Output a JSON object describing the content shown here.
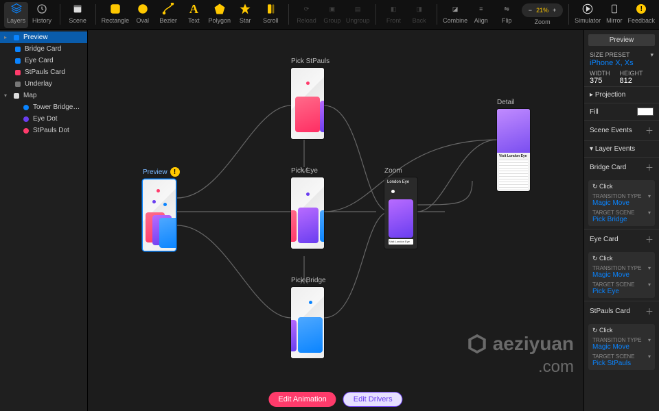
{
  "toolbar": {
    "layers": "Layers",
    "history": "History",
    "scene": "Scene",
    "rectangle": "Rectangle",
    "oval": "Oval",
    "bezier": "Bezier",
    "text": "Text",
    "polygon": "Polygon",
    "star": "Star",
    "scroll": "Scroll",
    "reload": "Reload",
    "group": "Group",
    "ungroup": "Ungroup",
    "front": "Front",
    "back": "Back",
    "combine": "Combine",
    "align": "Align",
    "flip": "Flip",
    "zoom": "Zoom",
    "zoom_value": "21%",
    "simulator": "Simulator",
    "mirror": "Mirror",
    "feedback": "Feedback"
  },
  "sidebar": {
    "items": [
      {
        "label": "Preview",
        "color": "#0a84ff",
        "sel": true
      },
      {
        "label": "Bridge Card",
        "color": "#0a84ff"
      },
      {
        "label": "Eye Card",
        "color": "#0a84ff"
      },
      {
        "label": "StPauls Card",
        "color": "#ff3b6b"
      },
      {
        "label": "Underlay",
        "color": "#888"
      }
    ],
    "map_label": "Map",
    "map_children": [
      {
        "label": "Tower Bridge…",
        "color": "#0a84ff"
      },
      {
        "label": "Eye Dot",
        "color": "#6a3ef0"
      },
      {
        "label": "StPauls Dot",
        "color": "#ff3b6b"
      }
    ]
  },
  "canvas": {
    "nodes": {
      "preview": "Preview",
      "pick_stpauls": "Pick StPauls",
      "pick_eye": "Pick Eye",
      "pick_bridge": "Pick Bridge",
      "zoom": "Zoom",
      "detail": "Detail",
      "zoom_caption": "London Eye",
      "detail_caption": "Visit London Eye"
    },
    "buttons": {
      "edit_animation": "Edit Animation",
      "edit_drivers": "Edit Drivers"
    },
    "watermark": {
      "brand": "aeziyuan",
      "suffix": ".com"
    }
  },
  "inspector": {
    "title": "Preview",
    "size_preset_label": "SIZE PRESET",
    "size_preset": "iPhone X, Xs",
    "width_label": "WIDTH",
    "width": "375",
    "height_label": "HEIGHT",
    "height": "812",
    "projection": "Projection",
    "fill": "Fill",
    "scene_events": "Scene Events",
    "layer_events": "Layer Events",
    "groups": [
      {
        "name": "Bridge Card",
        "trigger": "Click",
        "tt_label": "TRANSITION TYPE",
        "tt": "Magic Move",
        "ts_label": "TARGET SCENE",
        "ts": "Pick Bridge"
      },
      {
        "name": "Eye Card",
        "trigger": "Click",
        "tt_label": "TRANSITION TYPE",
        "tt": "Magic Move",
        "ts_label": "TARGET SCENE",
        "ts": "Pick Eye"
      },
      {
        "name": "StPauls Card",
        "trigger": "Click",
        "tt_label": "TRANSITION TYPE",
        "tt": "Magic Move",
        "ts_label": "TARGET SCENE",
        "ts": "Pick StPauls"
      }
    ]
  }
}
